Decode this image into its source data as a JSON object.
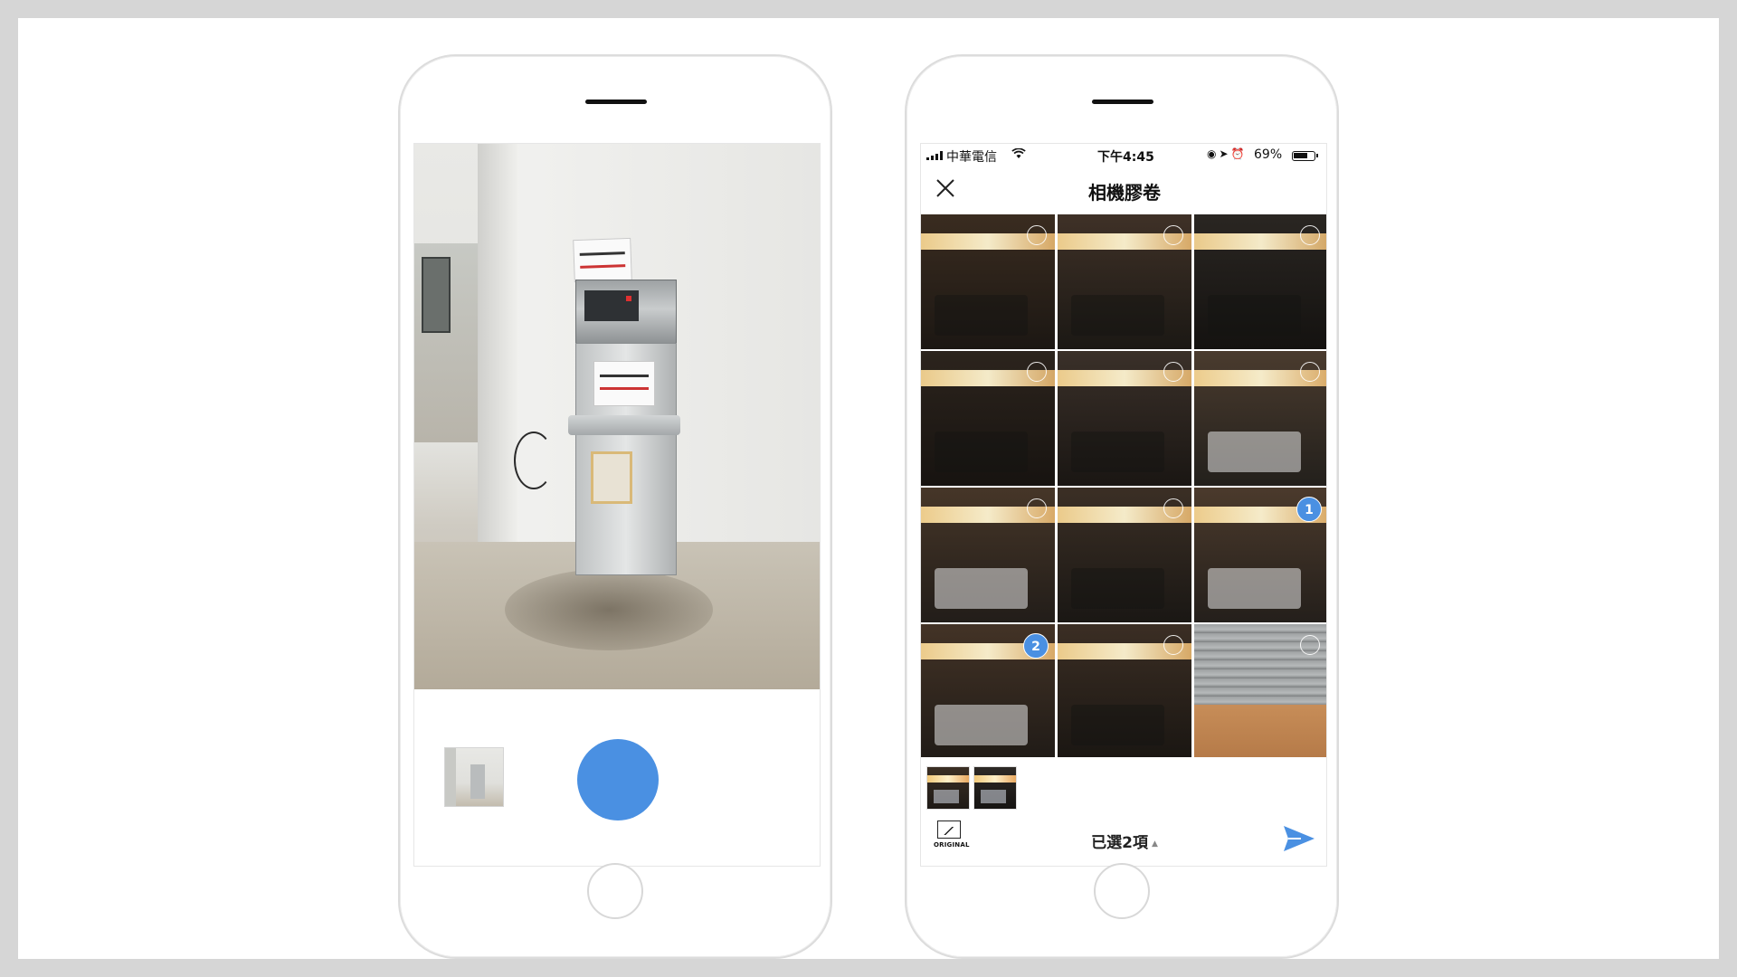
{
  "camera_screen": {
    "shutter_button": "",
    "last_photo_thumbnail": ""
  },
  "gallery_screen": {
    "status_bar": {
      "carrier": "中華電信",
      "time": "下午4:45",
      "battery": "69%",
      "icons": [
        "signal-icon",
        "wifi-icon",
        "orientation-lock-icon",
        "location-icon",
        "alarm-icon",
        "battery-icon"
      ]
    },
    "title": "相機膠卷",
    "photos": [
      {
        "badge": ""
      },
      {
        "badge": ""
      },
      {
        "badge": ""
      },
      {
        "badge": ""
      },
      {
        "badge": ""
      },
      {
        "badge": ""
      },
      {
        "badge": ""
      },
      {
        "badge": ""
      },
      {
        "badge": "1"
      },
      {
        "badge": "2"
      },
      {
        "badge": ""
      },
      {
        "badge": ""
      },
      {
        "badge": ""
      },
      {
        "badge": ""
      },
      {
        "badge": ""
      }
    ],
    "selected_thumbnails": 2,
    "original_label": "ORIGINAL",
    "selected_count_label": "已選2項",
    "colors": {
      "accent": "#4a90e2",
      "text": "#111111"
    }
  }
}
